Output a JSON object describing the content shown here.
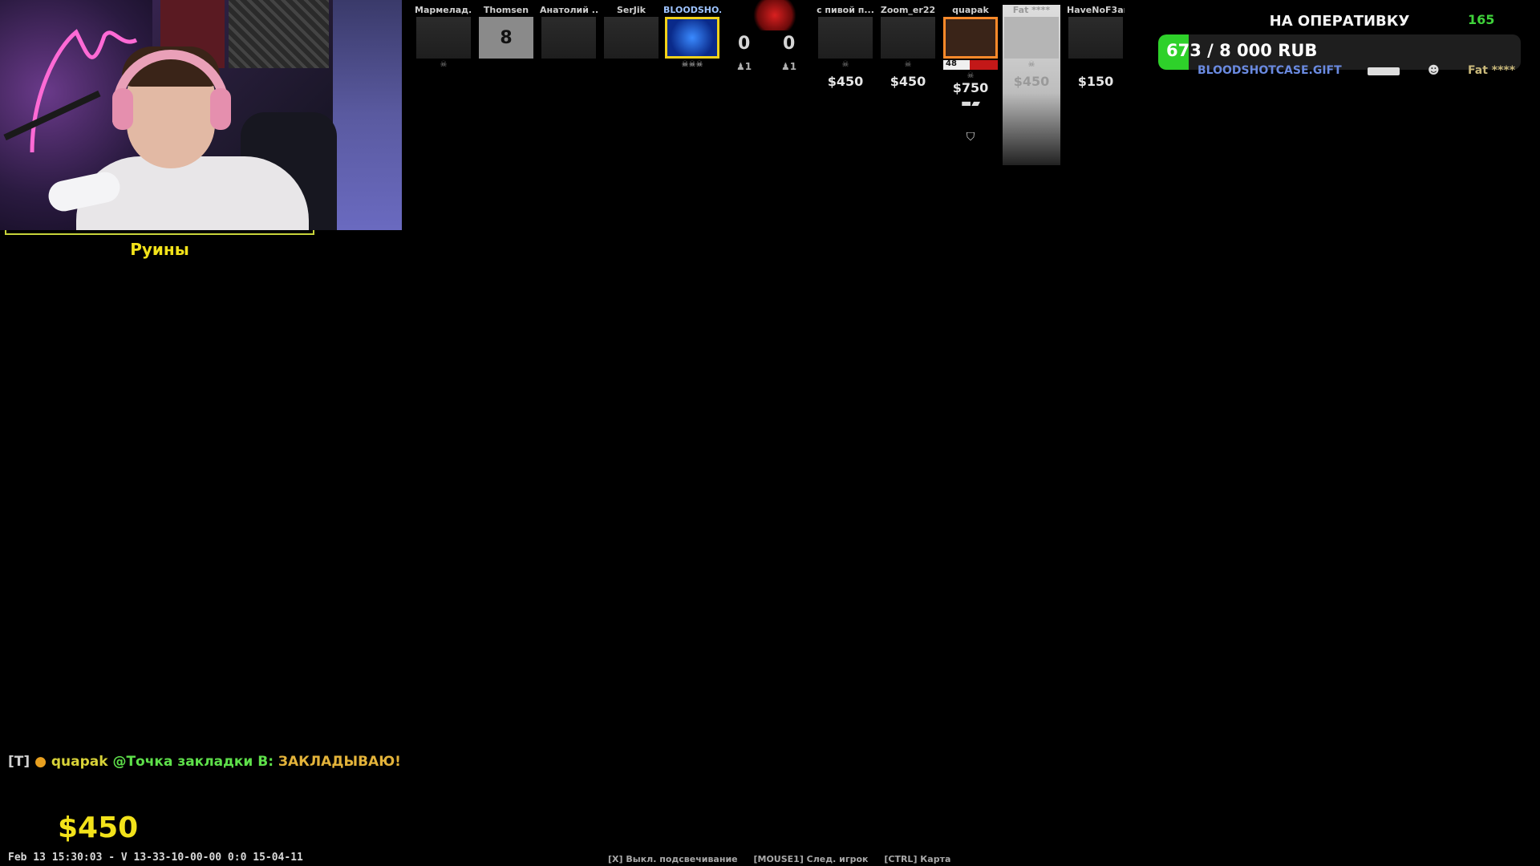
{
  "webcam": {
    "location_label": "Руины"
  },
  "scoreboard": {
    "ct_players": [
      {
        "name": "Мармелад...",
        "money": ""
      },
      {
        "name": "Thomsen",
        "money": "",
        "avatar_text": "8"
      },
      {
        "name": "Анатолий ...",
        "money": ""
      },
      {
        "name": "SerJik",
        "money": ""
      },
      {
        "name": "BLOODSHO...",
        "money": ""
      }
    ],
    "score_left": "0",
    "score_right": "0",
    "alive_left": "1",
    "alive_right": "1",
    "t_players": [
      {
        "name": "с пивой п...",
        "money": "$450"
      },
      {
        "name": "Zoom_er22",
        "money": "$450"
      },
      {
        "name": "quapak",
        "money": "$750",
        "hp": "48",
        "hp_fraction": 0.48
      },
      {
        "name": "Fat ****",
        "money": "$450"
      },
      {
        "name": "HaveNoF3ar",
        "money": "$150"
      }
    ]
  },
  "donation": {
    "title": "НА ОПЕРАТИВКУ",
    "count": "165",
    "progress_label": "673 / 8 000 RUB",
    "progress_fraction": 0.084,
    "accent_color": "#2ed12a"
  },
  "killfeed": {
    "killer": "BLOODSHOTCASE.GIFT",
    "victim": "Fat ****",
    "headshot_icon": "headshot-icon"
  },
  "chat": {
    "team_tag": "[T]",
    "dot": "●",
    "user": "quapak",
    "location": "@Точка закладки B:",
    "message": "ЗАКЛАДЫВАЮ!"
  },
  "hud": {
    "money": "$450",
    "status_line": "Feb 13 15:30:03 - V 13-33-10-00-00 0:0 15-04-11",
    "hints": [
      "[X] Выкл. подсвечивание",
      "[MOUSE1] След. игрок",
      "[CTRL] Карта"
    ]
  }
}
